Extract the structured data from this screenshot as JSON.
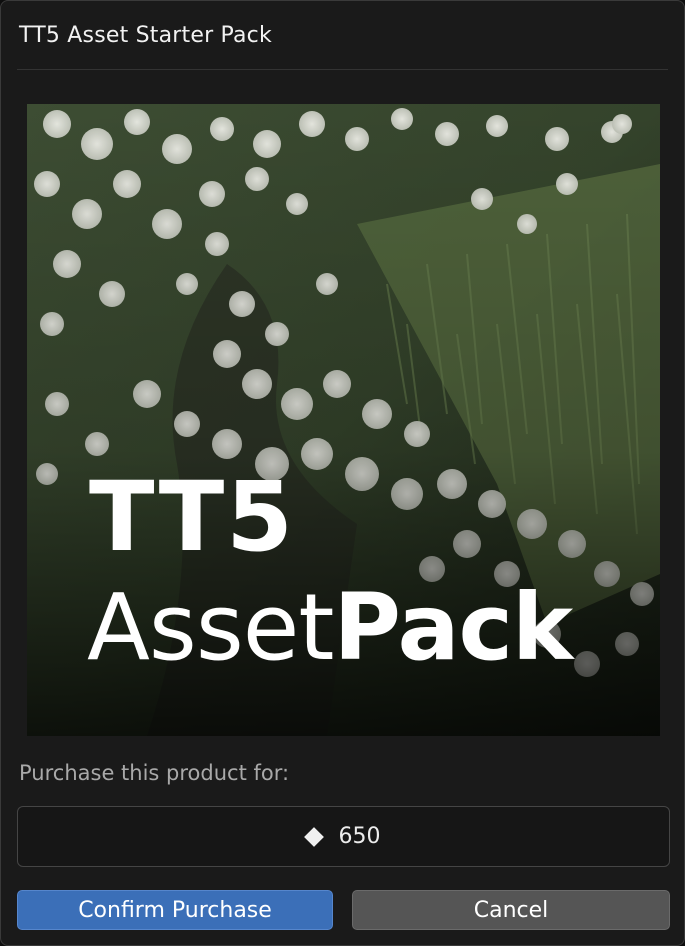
{
  "dialog": {
    "title": "TT5 Asset Starter Pack"
  },
  "product": {
    "image_line1": "TT5",
    "image_line2_light": "Asset",
    "image_line2_bold": "Pack"
  },
  "purchase": {
    "prompt": "Purchase this product for:",
    "currency_icon": "diamond-icon",
    "price": "650"
  },
  "buttons": {
    "confirm_label": "Confirm Purchase",
    "cancel_label": "Cancel"
  },
  "colors": {
    "accent": "#3b6fb8",
    "secondary": "#555555",
    "background": "#1a1a1a"
  }
}
